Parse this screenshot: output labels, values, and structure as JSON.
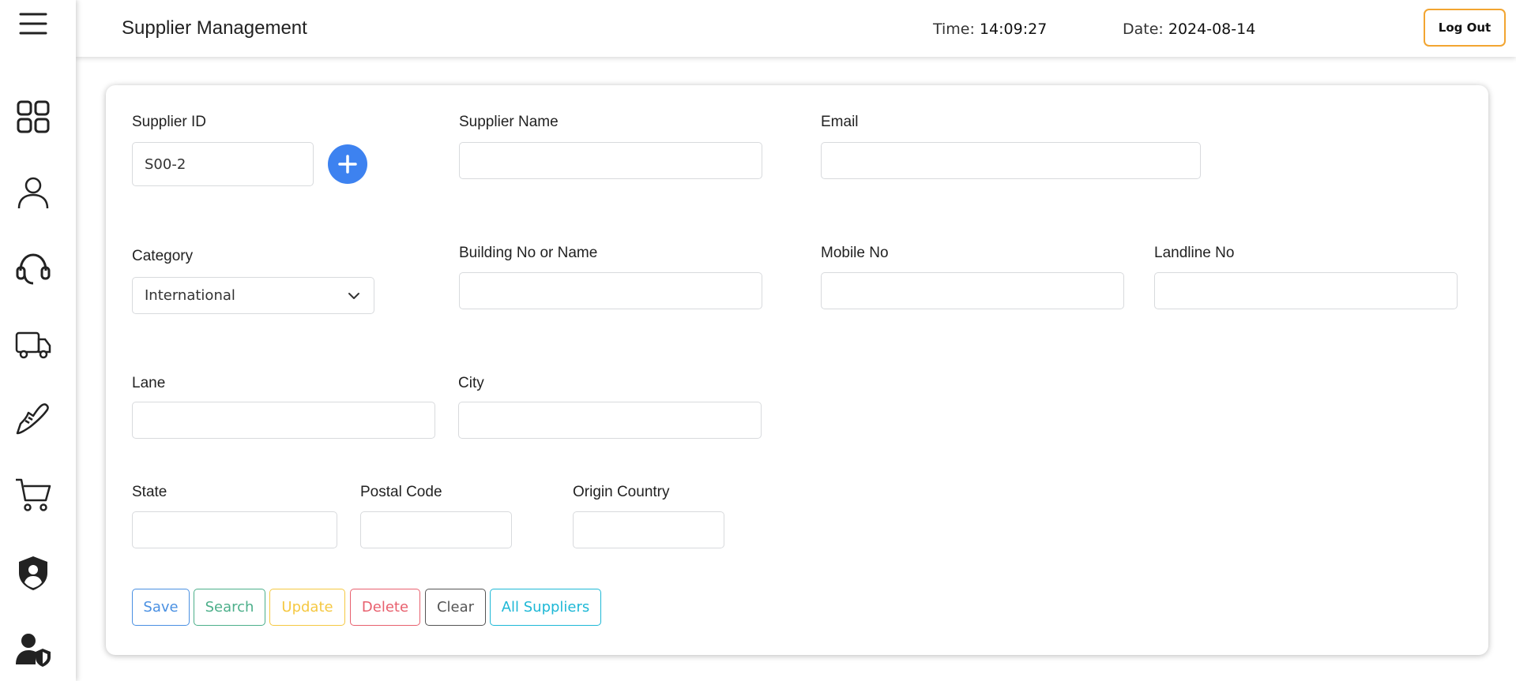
{
  "header": {
    "title": "Supplier Management",
    "time_label": "Time:",
    "time_value": "14:09:27",
    "date_label": "Date:",
    "date_value": "2024-08-14",
    "logout_label": "Log Out"
  },
  "sidebar": {
    "items": [
      {
        "name": "menu-icon"
      },
      {
        "name": "dashboard-icon"
      },
      {
        "name": "user-icon"
      },
      {
        "name": "headset-icon"
      },
      {
        "name": "truck-icon"
      },
      {
        "name": "shoe-icon"
      },
      {
        "name": "cart-icon"
      },
      {
        "name": "shield-user-icon"
      },
      {
        "name": "user-shield-icon"
      }
    ]
  },
  "form": {
    "supplier_id": {
      "label": "Supplier ID",
      "value": "S00-2"
    },
    "supplier_name": {
      "label": "Supplier Name",
      "value": ""
    },
    "email": {
      "label": "Email",
      "value": ""
    },
    "category": {
      "label": "Category",
      "value": "International"
    },
    "building": {
      "label": "Building No or Name",
      "value": ""
    },
    "mobile": {
      "label": "Mobile No",
      "value": ""
    },
    "landline": {
      "label": "Landline No",
      "value": ""
    },
    "lane": {
      "label": "Lane",
      "value": ""
    },
    "city": {
      "label": "City",
      "value": ""
    },
    "state": {
      "label": "State",
      "value": ""
    },
    "postal_code": {
      "label": "Postal Code",
      "value": ""
    },
    "origin_country": {
      "label": "Origin Country",
      "value": ""
    }
  },
  "buttons": {
    "save": {
      "label": "Save",
      "color": "#4a90e2"
    },
    "search": {
      "label": "Search",
      "color": "#4caf8a"
    },
    "update": {
      "label": "Update",
      "color": "#f5c842"
    },
    "delete": {
      "label": "Delete",
      "color": "#e8606e"
    },
    "clear": {
      "label": "Clear",
      "color": "#555555"
    },
    "all_suppliers": {
      "label": "All Suppliers",
      "color": "#1eb8d6"
    }
  },
  "colors": {
    "accent_blue": "#3d82f0",
    "logout_border": "#f2a531"
  }
}
